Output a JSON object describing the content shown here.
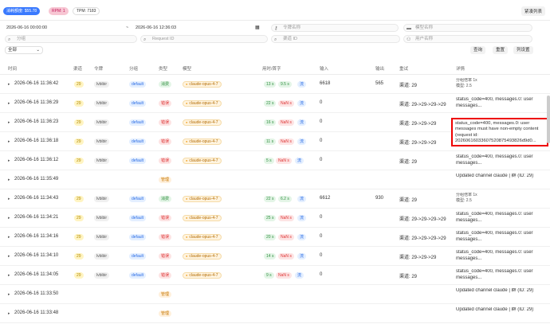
{
  "stats": {
    "quota": "消耗额度: $55.78",
    "rpm": "RPM: 1",
    "tpm": "TPM: 7183"
  },
  "collapse_label": "紧凑列表",
  "filters": {
    "start_time": "2026-06-16 00:00:00",
    "separator": "~",
    "end_time": "2026-06-16 12:36:03",
    "token_placeholder": "令牌名称",
    "model_placeholder": "模型名称",
    "group_placeholder": "分组",
    "request_placeholder": "Request ID",
    "channel_placeholder": "渠道 ID",
    "user_placeholder": "用户名称"
  },
  "type_select": "全部",
  "buttons": {
    "query": "查询",
    "reset": "重置",
    "settings": "列设置"
  },
  "columns": [
    "时间",
    "渠道",
    "令牌",
    "分组",
    "类型",
    "模型",
    "用时/首字",
    "输入",
    "输出",
    "重试",
    "详情"
  ],
  "rows": [
    {
      "time": "2026-06-16 11:36:42",
      "channel": "29",
      "token": "lvbibir",
      "group": "default",
      "type": "消费",
      "type_class": "t-consume",
      "model": "claude-opus-4-7",
      "dur": "13 s",
      "first": "9.5 s",
      "stream": "流",
      "input": "6618",
      "output": "565",
      "retry": "渠道: 29",
      "detail": "分组倍率 1x\n模型: 2.5",
      "detail_small": true
    },
    {
      "time": "2026-06-16 11:36:29",
      "channel": "29",
      "token": "lvbibir",
      "group": "default",
      "type": "错误",
      "type_class": "t-error",
      "model": "claude-opus-4-7",
      "dur": "22 s",
      "first": "NaN s",
      "stream": "流",
      "input": "0",
      "output": "",
      "retry": "渠道: 29->29->29->29",
      "detail": "status_code=400, messages.0: user messages..."
    },
    {
      "time": "2026-06-16 11:36:23",
      "channel": "29",
      "token": "lvbibir",
      "group": "default",
      "type": "错误",
      "type_class": "t-error",
      "model": "claude-opus-4-7",
      "dur": "16 s",
      "first": "NaN s",
      "stream": "流",
      "input": "0",
      "output": "",
      "retry": "渠道: 29->29->29",
      "detail": ""
    },
    {
      "time": "2026-06-16 11:36:18",
      "channel": "29",
      "token": "lvbibir",
      "group": "default",
      "type": "错误",
      "type_class": "t-error",
      "model": "claude-opus-4-7",
      "dur": "11 s",
      "first": "NaN s",
      "stream": "流",
      "input": "0",
      "output": "",
      "retry": "渠道: 29->29->29",
      "detail": ""
    },
    {
      "time": "2026-06-16 11:36:12",
      "channel": "29",
      "token": "lvbibir",
      "group": "default",
      "type": "错误",
      "type_class": "t-error",
      "model": "claude-opus-4-7",
      "dur": "5 s",
      "first": "NaN s",
      "stream": "流",
      "input": "0",
      "output": "",
      "retry": "渠道: 29",
      "detail": "status_code=400, messages.0: user messages..."
    },
    {
      "time": "2026-06-16 11:35:49",
      "channel": "",
      "token": "",
      "group": "",
      "type": "管理",
      "type_class": "t-manage",
      "model": "",
      "dur": "",
      "first": "",
      "stream": "",
      "input": "",
      "output": "",
      "retry": "",
      "detail": "Updated channel claude | 群 (ID: 29)"
    },
    {
      "time": "2026-06-16 11:34:43",
      "channel": "29",
      "token": "lvbibir",
      "group": "default",
      "type": "消费",
      "type_class": "t-consume",
      "model": "claude-opus-4-7",
      "dur": "22 s",
      "first": "6.2 s",
      "stream": "流",
      "input": "6612",
      "output": "930",
      "retry": "渠道: 29",
      "detail": "分组倍率 1x\n模型: 2.5",
      "detail_small": true
    },
    {
      "time": "2026-06-16 11:34:21",
      "channel": "29",
      "token": "lvbibir",
      "group": "default",
      "type": "错误",
      "type_class": "t-error",
      "model": "claude-opus-4-7",
      "dur": "25 s",
      "first": "NaN s",
      "stream": "流",
      "input": "0",
      "output": "",
      "retry": "渠道: 29->29->29->29",
      "detail": "status_code=400, messages.0: user messages..."
    },
    {
      "time": "2026-06-16 11:34:16",
      "channel": "29",
      "token": "lvbibir",
      "group": "default",
      "type": "错误",
      "type_class": "t-error",
      "model": "claude-opus-4-7",
      "dur": "20 s",
      "first": "NaN s",
      "stream": "流",
      "input": "0",
      "output": "",
      "retry": "渠道: 29->29->29->29",
      "detail": "status_code=400, messages.0: user messages..."
    },
    {
      "time": "2026-06-16 11:34:10",
      "channel": "29",
      "token": "lvbibir",
      "group": "default",
      "type": "错误",
      "type_class": "t-error",
      "model": "claude-opus-4-7",
      "dur": "14 s",
      "first": "NaN s",
      "stream": "流",
      "input": "0",
      "output": "",
      "retry": "渠道: 29->29->29",
      "detail": "status_code=400, messages.0: user messages..."
    },
    {
      "time": "2026-06-16 11:34:05",
      "channel": "29",
      "token": "lvbibir",
      "group": "default",
      "type": "错误",
      "type_class": "t-error",
      "model": "claude-opus-4-7",
      "dur": "9 s",
      "first": "NaN s",
      "stream": "流",
      "input": "0",
      "output": "",
      "retry": "渠道: 29",
      "detail": "status_code=400, messages.0: user messages..."
    },
    {
      "time": "2026-06-16 11:33:50",
      "channel": "",
      "token": "",
      "group": "",
      "type": "管理",
      "type_class": "t-manage",
      "model": "",
      "dur": "",
      "first": "",
      "stream": "",
      "input": "",
      "output": "",
      "retry": "",
      "detail": "Updated channel claude | 群 (ID: 29)"
    },
    {
      "time": "2026-06-16 11:33:48",
      "channel": "",
      "token": "",
      "group": "",
      "type": "管理",
      "type_class": "t-manage",
      "model": "",
      "dur": "",
      "first": "",
      "stream": "",
      "input": "",
      "output": "",
      "retry": "",
      "detail": "Updated channel claude | 群 (ID: 29)"
    }
  ],
  "popup_text": "status_code=400, messages.0: user messages must have non-empty content (request id: 20260616033607520875493826d9d0..."
}
